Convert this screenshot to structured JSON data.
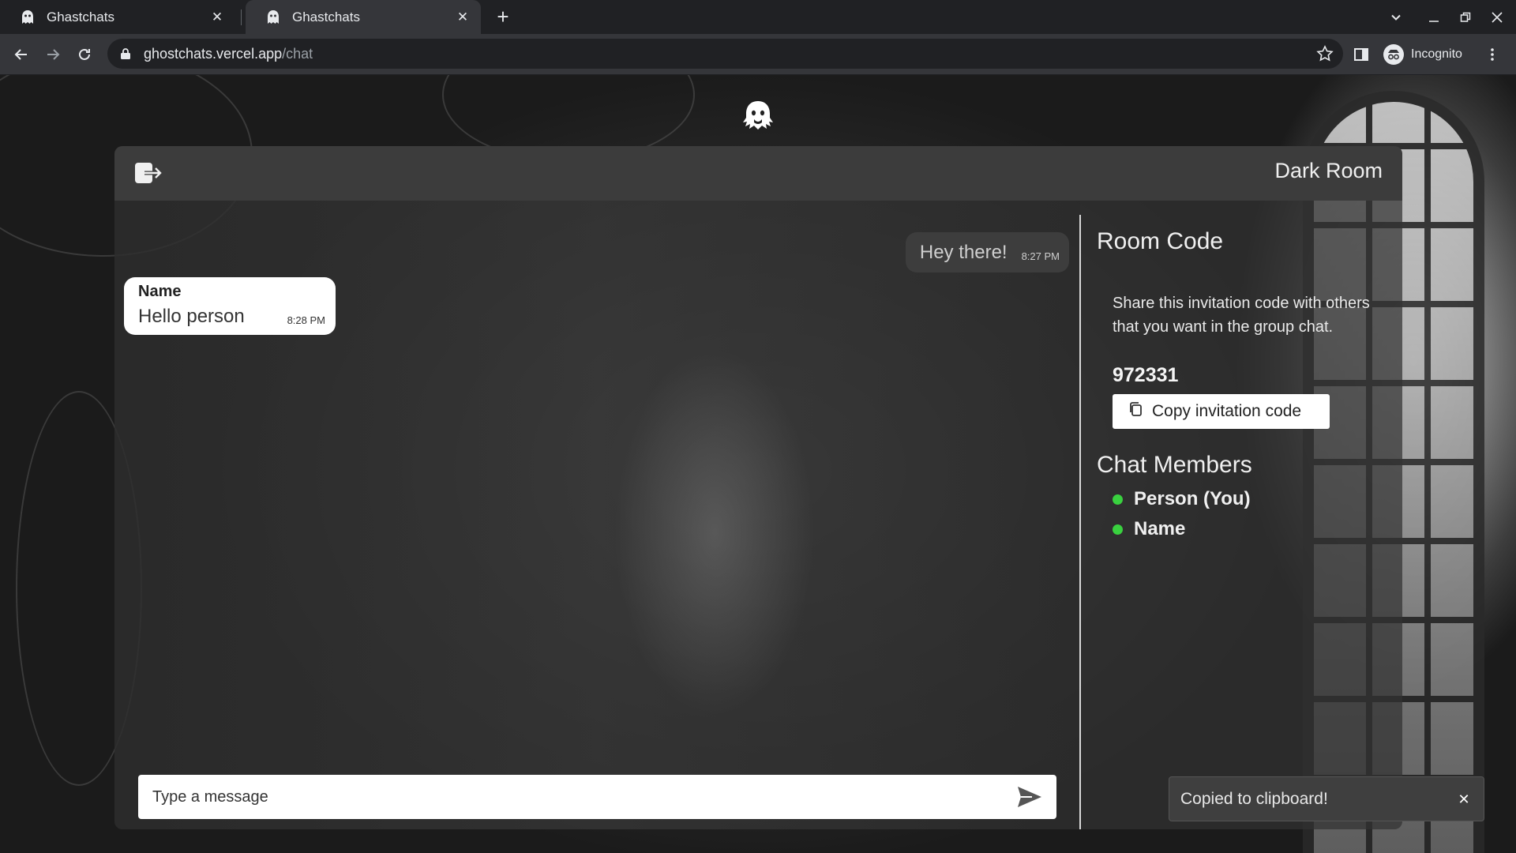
{
  "browser": {
    "tabs": [
      {
        "title": "Ghastchats",
        "active": false
      },
      {
        "title": "Ghastchats",
        "active": true
      }
    ],
    "address": {
      "host": "ghostchats.vercel.app",
      "path": "/chat"
    },
    "profile_label": "Incognito"
  },
  "app": {
    "room_name": "Dark Room",
    "messages": [
      {
        "direction": "outgoing",
        "text": "Hey there!",
        "time": "8:27 PM"
      },
      {
        "direction": "incoming",
        "sender": "Name",
        "text": "Hello person",
        "time": "8:28 PM"
      }
    ],
    "input_placeholder": "Type a message",
    "sidebar": {
      "room_code_title": "Room Code",
      "room_code_desc": "Share this invitation code with others that you want in the group chat.",
      "room_code": "972331",
      "copy_button": "Copy invitation code",
      "members_title": "Chat Members",
      "members": [
        {
          "name": "Person (You)",
          "status": "online"
        },
        {
          "name": "Name",
          "status": "online"
        }
      ]
    },
    "toast": "Copied to clipboard!"
  },
  "colors": {
    "online": "#39d13f",
    "bubble_in": "#ffffff",
    "bubble_out": "#3d3d3d"
  }
}
